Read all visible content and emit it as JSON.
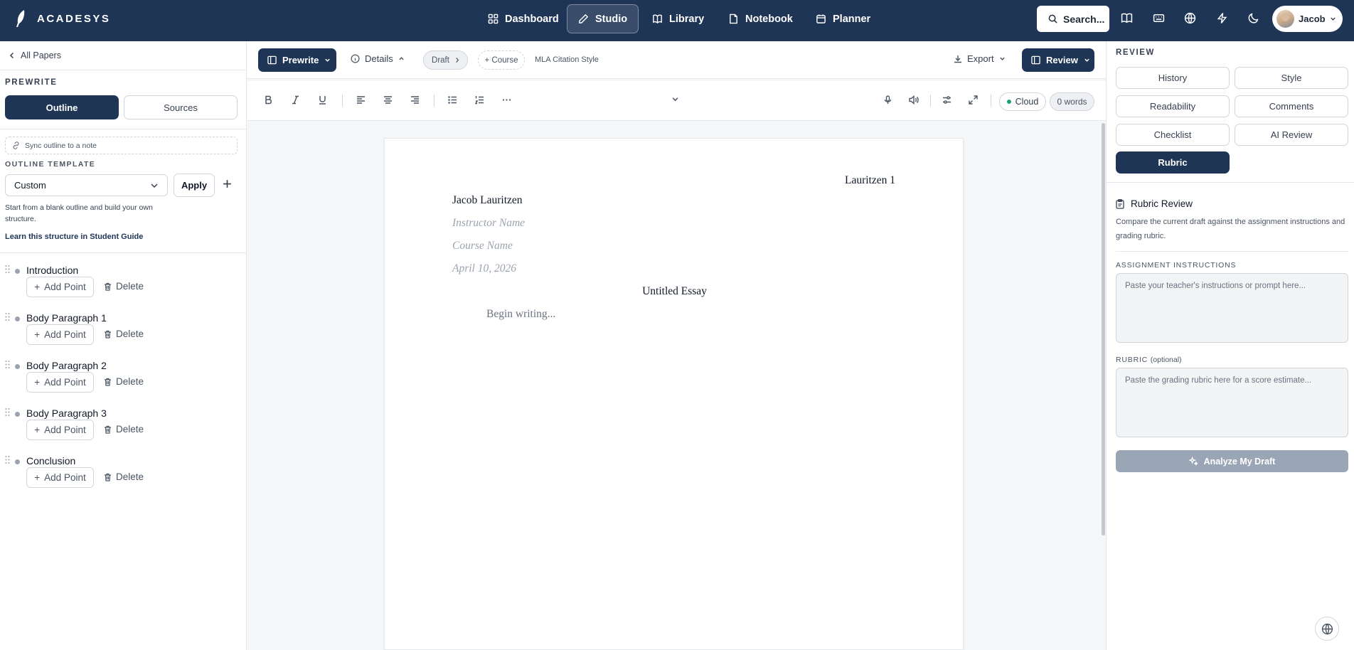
{
  "app": {
    "name": "ACADESYS"
  },
  "nav": {
    "items": [
      {
        "label": "Dashboard",
        "icon": "dashboard-icon"
      },
      {
        "label": "Studio",
        "icon": "pen-icon",
        "active": true
      },
      {
        "label": "Library",
        "icon": "book-icon"
      },
      {
        "label": "Notebook",
        "icon": "note-icon"
      },
      {
        "label": "Planner",
        "icon": "calendar-icon"
      }
    ],
    "search_label": "Search...",
    "user_name": "Jacob"
  },
  "left": {
    "back_label": "All Papers",
    "section_title": "PREWRITE",
    "tabs": [
      {
        "label": "Outline",
        "active": true
      },
      {
        "label": "Sources"
      }
    ],
    "sync_label": "Sync outline to a note",
    "template_title": "OUTLINE TEMPLATE",
    "template_value": "Custom",
    "apply_label": "Apply",
    "hint": "Start from a blank outline and build your own structure.",
    "guide_link": "Learn this structure in Student Guide",
    "outline": [
      {
        "title": "Introduction"
      },
      {
        "title": "Body Paragraph 1"
      },
      {
        "title": "Body Paragraph 2"
      },
      {
        "title": "Body Paragraph 3"
      },
      {
        "title": "Conclusion"
      }
    ],
    "add_point_label": "Add Point",
    "delete_label": "Delete"
  },
  "toolbar": {
    "prewrite_label": "Prewrite",
    "details_label": "Details",
    "draft_label": "Draft",
    "course_label": "+ Course",
    "citation_style": "MLA Citation Style",
    "export_label": "Export",
    "review_label": "Review",
    "cloud_label": "Cloud",
    "word_count": "0 words"
  },
  "paper": {
    "header": "Lauritzen 1",
    "author": "Jacob Lauritzen",
    "instructor": "Instructor Name",
    "course": "Course Name",
    "date": "April 10, 2026",
    "title": "Untitled Essay",
    "body_placeholder": "Begin writing..."
  },
  "review": {
    "title": "REVIEW",
    "buttons": [
      {
        "label": "History"
      },
      {
        "label": "Style"
      },
      {
        "label": "Readability"
      },
      {
        "label": "Comments"
      },
      {
        "label": "Checklist"
      },
      {
        "label": "AI Review"
      },
      {
        "label": "Rubric",
        "active": true
      }
    ],
    "rubric_title": "Rubric Review",
    "rubric_desc": "Compare the current draft against the assignment instructions and grading rubric.",
    "instructions_label": "ASSIGNMENT INSTRUCTIONS",
    "instructions_placeholder": "Paste your teacher's instructions or prompt here...",
    "rubric_label": "RUBRIC",
    "rubric_optional": "(optional)",
    "rubric_placeholder": "Paste the grading rubric here for a score estimate...",
    "analyze_label": "Analyze My Draft"
  },
  "colors": {
    "brand": "#1e3556",
    "cloud_status": "#22a06b",
    "disabled_button": "#9aa6b5"
  }
}
